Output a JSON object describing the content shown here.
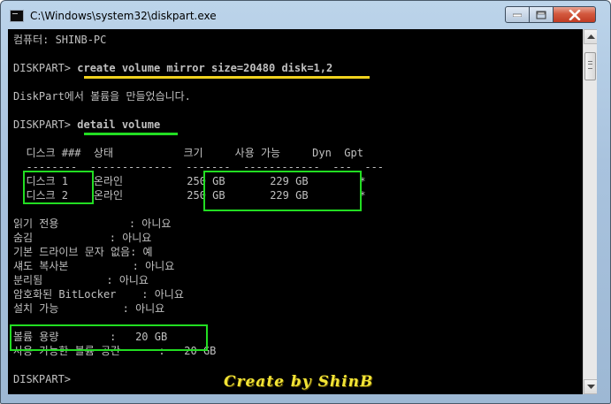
{
  "window": {
    "title": "C:\\Windows\\system32\\diskpart.exe",
    "icon": "console-icon",
    "controls": {
      "minimize": "minimize-icon",
      "maximize": "maximize-icon",
      "close": "close-icon"
    }
  },
  "console": {
    "computer_line": "컴퓨터: SHINB-PC",
    "prompt": "DISKPART> ",
    "command1": "create volume mirror size=20480 disk=1,2",
    "result1": "DiskPart에서 볼륨을 만들었습니다.",
    "command2": "detail volume",
    "table": {
      "header": "  디스크 ###  상태           크기     사용 가능     Dyn  Gpt",
      "separator": "  --------  -------------  -------  ------------  ---  ---",
      "rows": [
        "  디스크 1    온라인          250 GB       229 GB        *",
        "  디스크 2    온라인          250 GB       229 GB        *"
      ]
    },
    "attributes": [
      "읽기 전용           : 아니요",
      "숨김            : 아니요",
      "기본 드라이브 문자 없음: 예",
      "섀도 복사본          : 아니요",
      "분리됨          : 아니요",
      "암호화된 BitLocker    : 아니요",
      "설치 가능          : 아니요"
    ],
    "volume_capacity": "볼륨 용량        :   20 GB",
    "usable_space": "사용 가능한 볼륨 공간      :   20 GB",
    "final_prompt": "DISKPART> "
  },
  "watermark": "Create by ShinB",
  "colors": {
    "console_bg": "#000000",
    "console_text": "#c0c0c0",
    "highlight_box": "#22dd22",
    "command_underline": "#f0d21e",
    "detail_underline": "#22dd22",
    "watermark": "#f2e436"
  }
}
